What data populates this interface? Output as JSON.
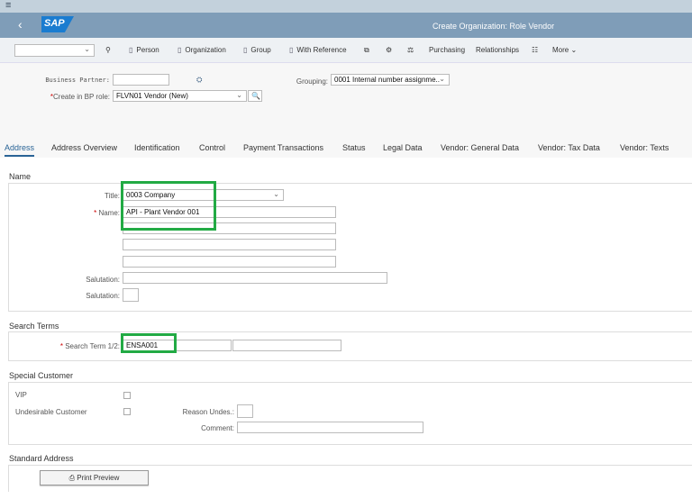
{
  "shell": {
    "menu_icon": "hamburger-icon",
    "back_icon": "back-icon",
    "logo": "SAP",
    "title": "Create Organization: Role Vendor"
  },
  "toolbar": {
    "dropdown_value": "",
    "items": [
      "Person",
      "Organization",
      "Group",
      "With Reference",
      "Purchasing",
      "Relationships",
      "More"
    ]
  },
  "header_form": {
    "business_partner_label": "Business Partner:",
    "business_partner_value": "",
    "bp_role_label": "Create in BP role:",
    "bp_role_value": "FLVN01 Vendor (New)",
    "grouping_label": "Grouping:",
    "grouping_value": "0001 Internal number assignme.."
  },
  "tabs": [
    "Address",
    "Address Overview",
    "Identification",
    "Control",
    "Payment Transactions",
    "Status",
    "Legal Data",
    "Vendor: General Data",
    "Vendor: Tax Data",
    "Vendor: Texts"
  ],
  "name_section": {
    "heading": "Name",
    "title_label": "Title:",
    "title_value": "0003 Company",
    "name_label": "Name:",
    "name_value": "API - Plant Vendor 001",
    "salutation_label": "Salutation:",
    "salutation2_label": "Salutation:"
  },
  "search_terms": {
    "heading": "Search Terms",
    "label": "Search Term 1/2:",
    "value1": "ENSA001",
    "value2": ""
  },
  "special_customer": {
    "heading": "Special Customer",
    "vip_label": "VIP",
    "undesirable_label": "Undesirable Customer",
    "reason_label": "Reason Undes.:",
    "comment_label": "Comment:"
  },
  "standard_address": {
    "heading": "Standard Address",
    "print_preview": "Print Preview"
  },
  "colors": {
    "shell": "#7f9db8",
    "highlight": "#22aa44",
    "active_tab": "#2a6496"
  }
}
